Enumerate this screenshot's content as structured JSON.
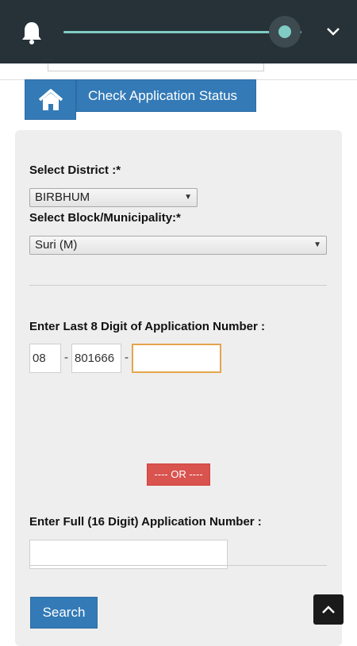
{
  "status_bar": {
    "notification_icon": "bell-icon",
    "brightness_level": 0.93,
    "expand_icon": "chevron-down-icon"
  },
  "header": {
    "home_icon": "home-icon",
    "title": "Check Application Status"
  },
  "form": {
    "district_label": "Select District :*",
    "district_value": "BIRBHUM",
    "block_label": "Select Block/Municipality:*",
    "block_value": "Suri (M)",
    "last8_label": "Enter Last 8 Digit of Application Number :",
    "part1_value": "08",
    "part2_value": "801666",
    "part3_value": "",
    "separator": "-",
    "or_label": "---- OR ----",
    "full_label": "Enter Full (16 Digit) Application Number :",
    "full_value": "",
    "search_label": "Search"
  },
  "scroll_top_icon": "chevron-up-icon",
  "colors": {
    "primary": "#337ab7",
    "danger": "#d9534f",
    "shade_bg": "#263238",
    "slider": "#80cbc4",
    "focus_border": "#e5a54b"
  }
}
